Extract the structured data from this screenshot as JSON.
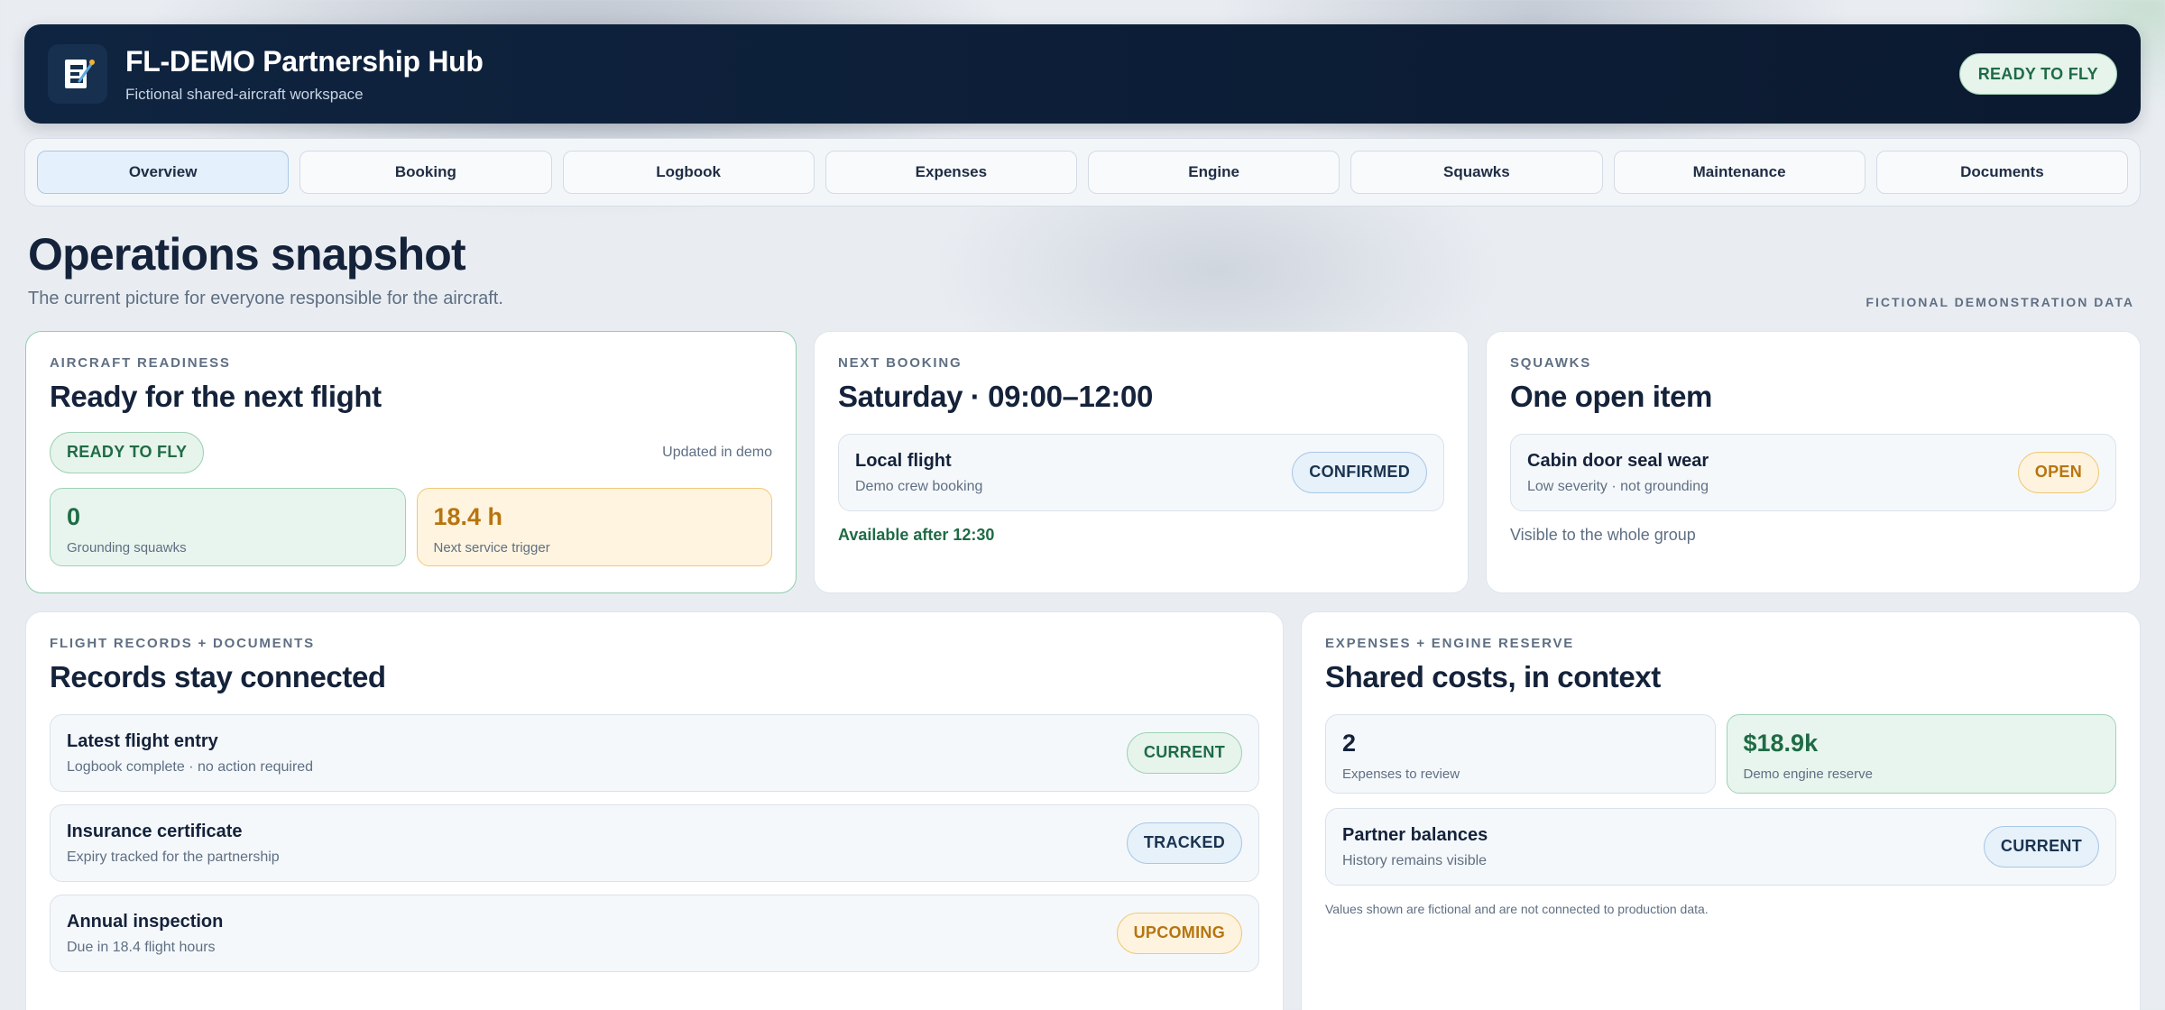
{
  "header": {
    "title": "FL-DEMO Partnership Hub",
    "subtitle": "Fictional shared-aircraft workspace",
    "status_badge": "READY TO FLY",
    "logo_icon": "aircraft-logo-icon"
  },
  "nav": {
    "tabs": [
      "Overview",
      "Booking",
      "Logbook",
      "Expenses",
      "Engine",
      "Squawks",
      "Maintenance",
      "Documents"
    ],
    "active_tab": "Overview"
  },
  "page": {
    "title": "Operations snapshot",
    "subtitle": "The current picture for everyone responsible for the aircraft.",
    "demo_label": "FICTIONAL DEMONSTRATION DATA"
  },
  "readiness": {
    "eyebrow": "AIRCRAFT READINESS",
    "title": "Ready for the next flight",
    "status": "READY TO FLY",
    "updated": "Updated in demo",
    "stats": [
      {
        "value": "0",
        "label": "Grounding squawks"
      },
      {
        "value": "18.4 h",
        "label": "Next service trigger"
      }
    ]
  },
  "booking": {
    "eyebrow": "NEXT BOOKING",
    "title": "Saturday · 09:00–12:00",
    "item_title": "Local flight",
    "item_sub": "Demo crew booking",
    "item_status": "CONFIRMED",
    "availability": "Available after 12:30"
  },
  "squawks": {
    "eyebrow": "SQUAWKS",
    "title": "One open item",
    "item_title": "Cabin door seal wear",
    "item_sub": "Low severity · not grounding",
    "item_status": "OPEN",
    "note": "Visible to the whole group"
  },
  "records": {
    "eyebrow": "FLIGHT RECORDS + DOCUMENTS",
    "title": "Records stay connected",
    "items": [
      {
        "title": "Latest flight entry",
        "sub": "Logbook complete · no action required",
        "status": "CURRENT"
      },
      {
        "title": "Insurance certificate",
        "sub": "Expiry tracked for the partnership",
        "status": "TRACKED"
      },
      {
        "title": "Annual inspection",
        "sub": "Due in 18.4 flight hours",
        "status": "UPCOMING"
      }
    ]
  },
  "costs": {
    "eyebrow": "EXPENSES + ENGINE RESERVE",
    "title": "Shared costs, in context",
    "stats": [
      {
        "value": "2",
        "label": "Expenses to review"
      },
      {
        "value": "$18.9k",
        "label": "Demo engine reserve"
      }
    ],
    "item_title": "Partner balances",
    "item_sub": "History remains visible",
    "item_status": "CURRENT",
    "footnote": "Values shown are fictional and are not connected to production data."
  },
  "colors": {
    "header_bg": "#0f2440",
    "accent_green": "#1f6b45",
    "accent_amber": "#b7750f",
    "accent_blue": "#1a3350"
  }
}
